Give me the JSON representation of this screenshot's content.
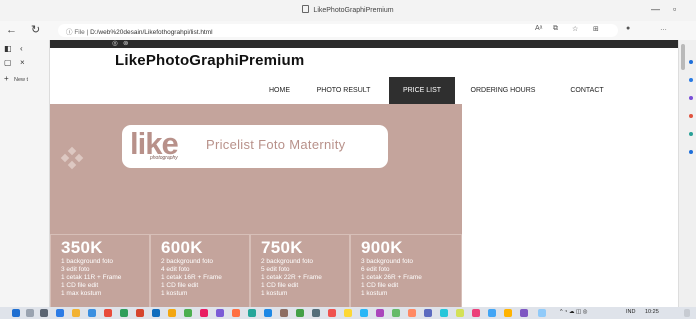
{
  "browser": {
    "window_title": "LikePhotoGraphiPremium",
    "url_scheme": "File",
    "url_path": "D:/web%20desain/Likefothograhpi/list.html",
    "new_tab_label": "New t"
  },
  "site": {
    "logo": "LikePhotoGraphiPremium",
    "nav": [
      {
        "label": "HOME",
        "active": false
      },
      {
        "label": "PHOTO RESULT",
        "active": false
      },
      {
        "label": "PRICE LIST",
        "active": true
      },
      {
        "label": "ORDERING HOURS",
        "active": false
      },
      {
        "label": "CONTACT",
        "active": false
      }
    ]
  },
  "banner": {
    "logo_text": "like",
    "logo_sub": "photography",
    "title": "Pricelist Foto Maternity",
    "background_color": "#c4a49c"
  },
  "prices": [
    {
      "amount": "350K",
      "lines": [
        "1 background foto",
        "3 edit foto",
        "1 cetak 11R + Frame",
        "1 CD file edit",
        "1 max kostum"
      ]
    },
    {
      "amount": "600K",
      "lines": [
        "2 background foto",
        "4 edit foto",
        "1 cetak 16R + Frame",
        "1 CD file edit",
        "1 kostum"
      ]
    },
    {
      "amount": "750K",
      "lines": [
        "2 background foto",
        "5 edit foto",
        "1 cetak 22R + Frame",
        "1 CD file edit",
        "1 kostum"
      ]
    },
    {
      "amount": "900K",
      "lines": [
        "3 background foto",
        "6 edit foto",
        "1 cetak 26R + Frame",
        "1 CD file edit",
        "1 kostum"
      ]
    }
  ],
  "taskbar": {
    "tray_lang": "IND",
    "tray_time": "10:25"
  },
  "colors": {
    "accent_nav_active": "#2f2f2f",
    "topbar": "#2b2b2b",
    "brand_pink": "#b8918a"
  }
}
